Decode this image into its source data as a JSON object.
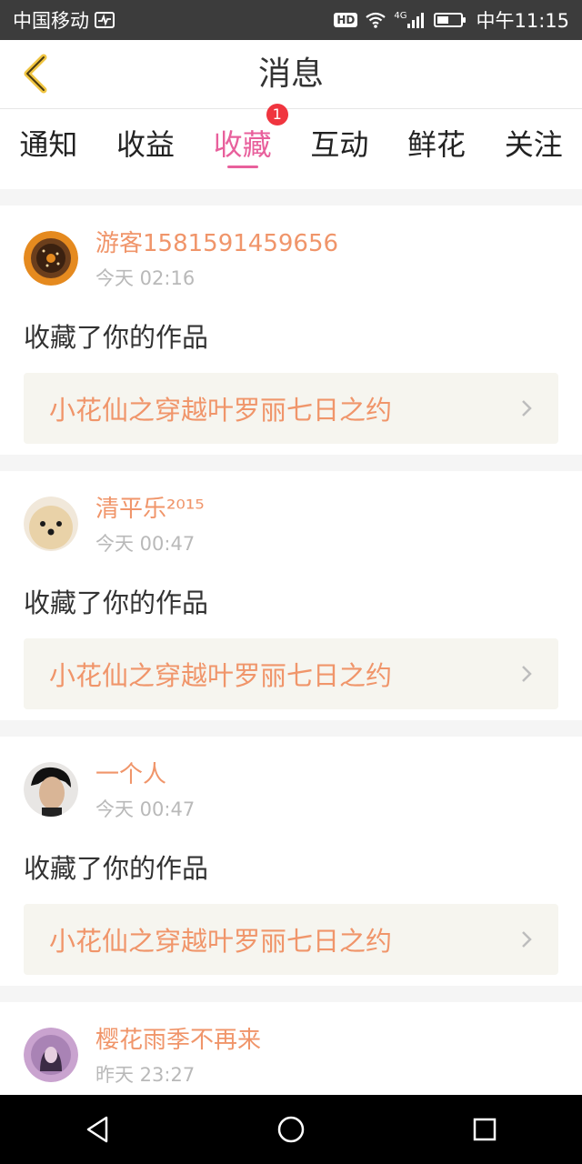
{
  "status_bar": {
    "carrier": "中国移动",
    "hd": "HD",
    "network": "4G",
    "time": "中午11:15"
  },
  "header": {
    "title": "消息",
    "back_icon": "chevron-left-icon"
  },
  "tabs": [
    {
      "label": "通知",
      "active": false
    },
    {
      "label": "收益",
      "active": false
    },
    {
      "label": "收藏",
      "active": true,
      "badge": "1"
    },
    {
      "label": "互动",
      "active": false
    },
    {
      "label": "鲜花",
      "active": false
    },
    {
      "label": "关注",
      "active": false
    }
  ],
  "messages": [
    {
      "username": "游客1581591459656",
      "time": "今天 02:16",
      "action": "收藏了你的作品",
      "work_title": "小花仙之穿越叶罗丽七日之约"
    },
    {
      "username": "清平乐²⁰¹⁵",
      "time": "今天 00:47",
      "action": "收藏了你的作品",
      "work_title": "小花仙之穿越叶罗丽七日之约"
    },
    {
      "username": "一个人",
      "time": "今天 00:47",
      "action": "收藏了你的作品",
      "work_title": "小花仙之穿越叶罗丽七日之约"
    },
    {
      "username": "樱花雨季不再来",
      "time": "昨天 23:27"
    }
  ],
  "colors": {
    "accent": "#e8609c",
    "username": "#f0956a",
    "badge": "#f0353f"
  }
}
